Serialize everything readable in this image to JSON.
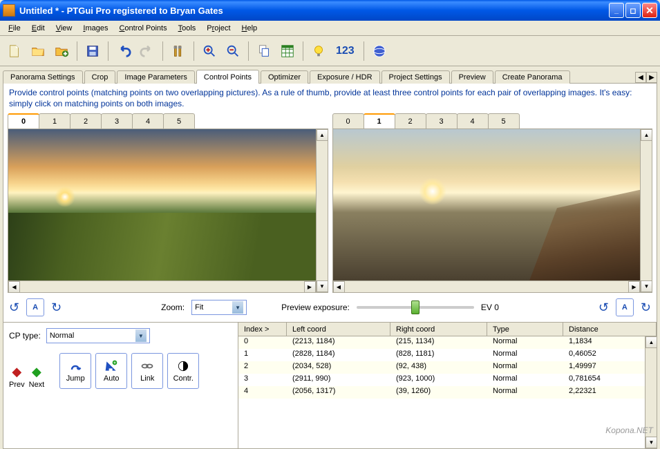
{
  "window": {
    "title": "Untitled * - PTGui Pro registered to Bryan Gates"
  },
  "menu": [
    "File",
    "Edit",
    "View",
    "Images",
    "Control Points",
    "Tools",
    "Project",
    "Help"
  ],
  "tabs": [
    "Panorama Settings",
    "Crop",
    "Image Parameters",
    "Control Points",
    "Optimizer",
    "Exposure / HDR",
    "Project Settings",
    "Preview",
    "Create Panorama"
  ],
  "active_tab": "Control Points",
  "instructions": "Provide control points (matching points on two overlapping pictures). As a rule of thumb, provide at least three control points for each pair of overlapping images. It's easy: simply click on matching points on both images.",
  "left_pane": {
    "tabs": [
      "0",
      "1",
      "2",
      "3",
      "4",
      "5"
    ],
    "active": "0"
  },
  "right_pane": {
    "tabs": [
      "0",
      "1",
      "2",
      "3",
      "4",
      "5"
    ],
    "active": "1"
  },
  "controls": {
    "a_label": "A",
    "zoom_label": "Zoom:",
    "zoom_value": "Fit",
    "preview_label": "Preview exposure:",
    "ev_label": "EV 0"
  },
  "cp": {
    "type_label": "CP type:",
    "type_value": "Normal",
    "prev": "Prev",
    "next": "Next",
    "jump": "Jump",
    "auto": "Auto",
    "link": "Link",
    "contr": "Contr."
  },
  "table": {
    "headers": {
      "index": "Index >",
      "left": "Left coord",
      "right": "Right coord",
      "type": "Type",
      "distance": "Distance"
    },
    "rows": [
      {
        "idx": "0",
        "left": "(2213, 1184)",
        "right": "(215, 1134)",
        "type": "Normal",
        "dist": "1,1834"
      },
      {
        "idx": "1",
        "left": "(2828, 1184)",
        "right": "(828, 1181)",
        "type": "Normal",
        "dist": "0,46052"
      },
      {
        "idx": "2",
        "left": "(2034, 528)",
        "right": "(92, 438)",
        "type": "Normal",
        "dist": "1,49997"
      },
      {
        "idx": "3",
        "left": "(2911, 990)",
        "right": "(923, 1000)",
        "type": "Normal",
        "dist": "0,781654"
      },
      {
        "idx": "4",
        "left": "(2056, 1317)",
        "right": "(39, 1260)",
        "type": "Normal",
        "dist": "2,22321"
      }
    ]
  },
  "toolbar_num": "123",
  "watermark": "Kopona.NET"
}
